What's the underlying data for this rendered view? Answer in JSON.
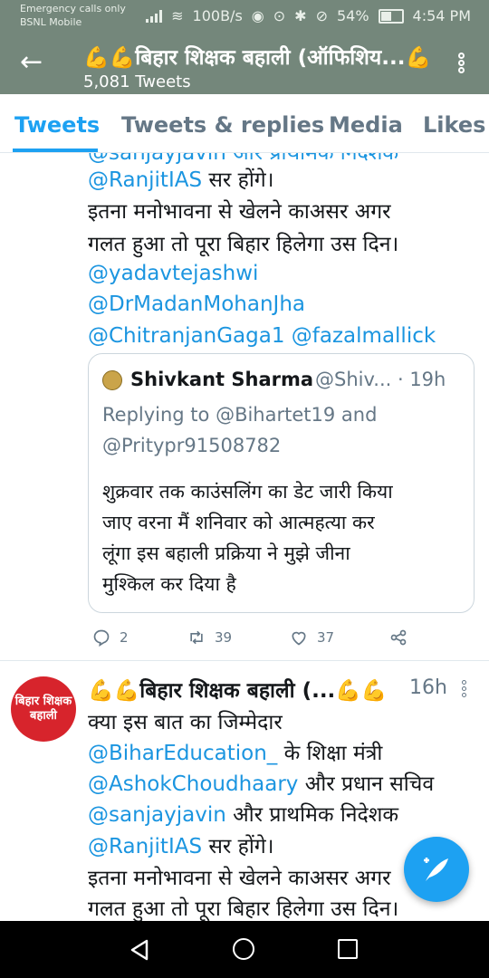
{
  "status_bar": {
    "carrier_line1": "Emergency calls only",
    "carrier_line2": "BSNL Mobile",
    "speed": "100B/s",
    "battery": "54%",
    "time": "4:54 PM"
  },
  "header": {
    "title": "💪💪बिहार शिक्षक बहाली (ऑफिशिय...💪",
    "tweet_count": "5,081 Tweets"
  },
  "tabs": [
    "Tweets",
    "Tweets & replies",
    "Media",
    "Likes"
  ],
  "tweet1": {
    "partial_top": "@sanjayjavin और प्राथमिक निदेशक",
    "line1_mention": "@RanjitIAS",
    "line1_rest": " सर होंगे।",
    "line2": "इतना मनोभावना से खेलने काअसर अगर",
    "line3": "गलत हुआ तो पूरा बिहार हिलेगा उस दिन।",
    "mention_a": "@yadavtejashwi",
    "mention_b": "@DrMadanMohanJha",
    "mention_c": "@ChitranjanGaga1",
    "mention_d": "@fazalmallick",
    "quote": {
      "name": "Shivkant Sharma",
      "meta": "@Shiv... · 19h",
      "reply_line1": "Replying to @Bihartet19 and",
      "reply_line2": "@Pritypr91508782",
      "text_line1": "शुक्रवार तक काउंसलिंग का डेट जारी किया",
      "text_line2": "जाए वरना मैं शनिवार को आत्महत्या कर",
      "text_line3": "लूंगा इस बहाली प्रक्रिया ने मुझे जीना",
      "text_line4": "मुश्किल कर दिया है"
    },
    "actions": {
      "replies": "2",
      "retweets": "39",
      "likes": "37"
    }
  },
  "tweet2": {
    "avatar_text_1": "बिहार शिक्षक",
    "avatar_text_2": "बहाली",
    "header": "💪💪बिहार शिक्षक बहाली (...💪💪",
    "time": "16h",
    "line1": "क्या इस बात का जिम्मेदार",
    "line2_mention": "@BiharEducation_",
    "line2_rest": " के शिक्षा मंत्री",
    "line3_mention": "@AshokChoudhaary",
    "line3_rest": "  और प्रधान सचिव",
    "line4_mention": "@sanjayjavin",
    "line4_rest": " और प्राथमिक निदेशक",
    "line5_mention": "@RanjitIAS",
    "line5_rest": " सर होंगे।",
    "line6": "इतना मनोभावना से खेलने काअसर अगर",
    "line7": "गलत हुआ तो पूरा बिहार हिलेगा उस दिन।"
  }
}
